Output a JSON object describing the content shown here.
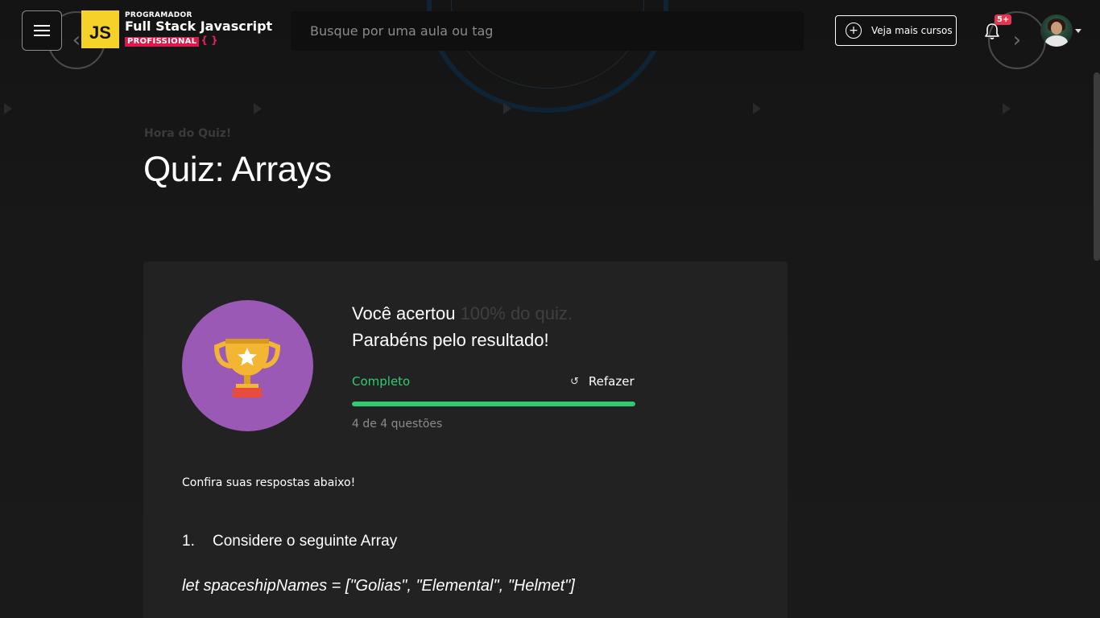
{
  "header": {
    "logo": {
      "badge": "JS",
      "line1": "PROGRAMADOR",
      "line2": "Full Stack Javascript",
      "line3": "PROFISSIONAL",
      "line3_suffix": "{ }"
    },
    "search_placeholder": "Busque por uma aula ou tag",
    "more_courses_label": "Veja mais cursos",
    "notifications_badge": "5+"
  },
  "hero": {
    "eyebrow": "Hora do Quiz!",
    "title": "Quiz: Arrays"
  },
  "result": {
    "line1_prefix": "Você acertou",
    "line1_muted": "100% do quiz.",
    "line2": "Parabéns pelo resultado!",
    "status": "Completo",
    "redo_label": "Refazer",
    "progress_fraction": 1.0,
    "count_text": "4 de 4 questões"
  },
  "answers": {
    "intro": "Confira suas respostas abaixo!",
    "questions": [
      {
        "number": "1.",
        "text": "Considere o seguinte Array",
        "code": "let spaceshipNames = [\"Golias\", \"Elemental\", \"Helmet\"]"
      }
    ]
  },
  "colors": {
    "accent_green": "#2ecc71",
    "trophy_bg": "#9b59b6",
    "badge_red": "#e8344e"
  }
}
